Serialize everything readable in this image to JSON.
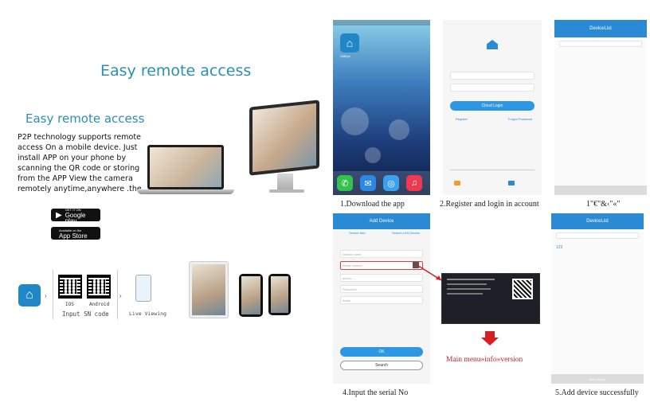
{
  "left": {
    "headline": "Easy remote access",
    "subhead": "Easy remote access",
    "description": "P2P technology supports remote access On a mobile device. Just install APP on your phone by scanning the QR code or storing from the APP View the camera remotely anytime,anywhere .the",
    "google_play": {
      "small": "GET IT ON",
      "label": "Google play"
    },
    "app_store": {
      "small": "Available on the",
      "label": "App Store"
    },
    "qr_labels": [
      "IOS",
      "Android"
    ],
    "input_caption": "Input SN code",
    "live_caption": "Live Viewing"
  },
  "steps": {
    "step1": "1.Download the app",
    "step2": "2.Register and login in account",
    "step3": "1\"€\"&‹\"«\"",
    "step4": "4.Input the serial No",
    "step5": "5.Add device successfully",
    "menu_path": "Main menu»info»version"
  },
  "screens": {
    "ios_app_name": "XMEye",
    "device_list_title": "DeviceList",
    "add_device_title": "Add Device",
    "add_device_tabs": [
      "Device Add",
      "Search LAN Device"
    ],
    "add_device_fields": [
      "Device name",
      "Serial number",
      "admin",
      "Password",
      "Audio"
    ],
    "ok_button": "OK",
    "search_button": "Search",
    "login_button": "Cloud Login",
    "login_links": [
      "Register",
      "Forgot Password"
    ],
    "device_entry": "123",
    "add_device_bottom": "Add Device"
  }
}
